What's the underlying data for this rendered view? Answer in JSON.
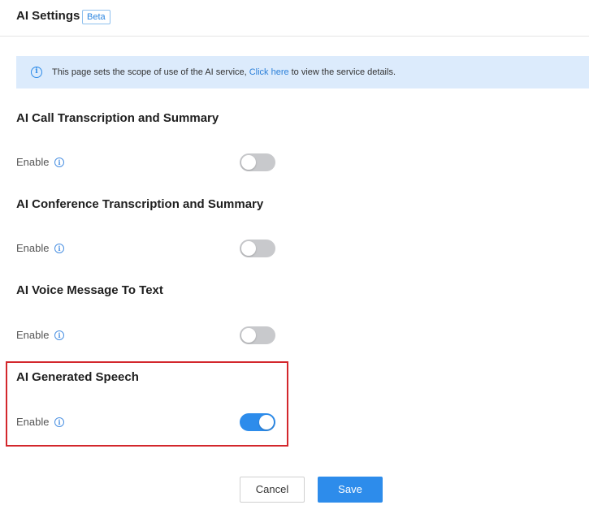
{
  "header": {
    "title": "AI Settings",
    "badge": "Beta"
  },
  "banner": {
    "icon": "info-icon",
    "text_before": "This page sets the scope of use of the AI service,",
    "link_text": "Click here",
    "text_after": "to view the service details."
  },
  "sections": [
    {
      "title": "AI Call Transcription and Summary",
      "enable_label": "Enable",
      "enabled": false
    },
    {
      "title": "AI Conference Transcription and Summary",
      "enable_label": "Enable",
      "enabled": false
    },
    {
      "title": "AI Voice Message To Text",
      "enable_label": "Enable",
      "enabled": false
    },
    {
      "title": "AI Generated Speech",
      "enable_label": "Enable",
      "enabled": true
    }
  ],
  "footer": {
    "cancel_label": "Cancel",
    "save_label": "Save"
  },
  "colors": {
    "accent": "#2d8ceb",
    "toggle_off": "#c8c9cc",
    "highlight": "#d3272c",
    "banner_bg": "#dcebfc"
  }
}
